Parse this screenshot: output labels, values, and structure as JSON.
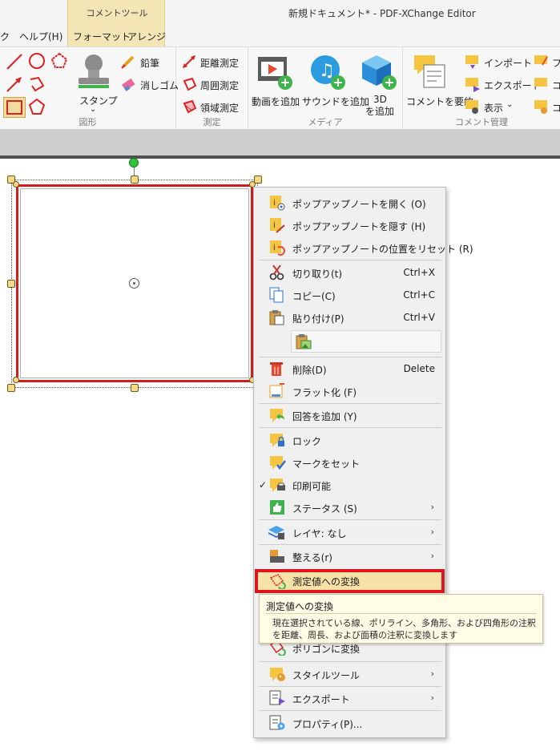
{
  "window": {
    "title": "新規ドキュメント* - PDF-XChange Editor",
    "context_tab_group": "コメントツール"
  },
  "menubar": {
    "items": [
      {
        "label": "ク"
      },
      {
        "label": "ヘルプ(H)"
      },
      {
        "label": "フォーマット"
      },
      {
        "label": "アレンジ"
      }
    ]
  },
  "ribbon": {
    "groups": {
      "shapes": {
        "label": "図形"
      },
      "measure": {
        "label": "測定"
      },
      "media": {
        "label": "メディア"
      },
      "comments": {
        "label": "コメント管理"
      }
    },
    "stamp": "スタンプ",
    "pencil": "鉛筆",
    "eraser": "消しゴム",
    "distance": "距離測定",
    "perimeter": "周囲測定",
    "area": "領域測定",
    "add_video": "動画を追加",
    "add_sound": "サウンドを追加",
    "add_3d_line1": "3D",
    "add_3d_line2": "を追加",
    "summarize": "コメントを要約",
    "import": "インポート",
    "export": "エクスポート",
    "view": "表示",
    "clip1": "フ",
    "clip2": "コ",
    "clip3": "コ"
  },
  "context_menu": {
    "items": [
      {
        "label": "ポップアップノートを開く (O)"
      },
      {
        "label": "ポップアップノートを隠す (H)"
      },
      {
        "label": "ポップアップノートの位置をリセット (R)"
      },
      {
        "label": "切り取り(t)",
        "shortcut": "Ctrl+X"
      },
      {
        "label": "コピー(C)",
        "shortcut": "Ctrl+C"
      },
      {
        "label": "貼り付け(P)",
        "shortcut": "Ctrl+V"
      },
      {
        "label": "削除(D)",
        "shortcut": "Delete"
      },
      {
        "label": "フラット化 (F)"
      },
      {
        "label": "回答を追加 (Y)"
      },
      {
        "label": "ロック"
      },
      {
        "label": "マークをセット"
      },
      {
        "label": "印刷可能",
        "checked": "✓"
      },
      {
        "label": "ステータス (S)",
        "arrow": "›"
      },
      {
        "label": "レイヤ: なし",
        "arrow": "›"
      },
      {
        "label": "整える(r)",
        "arrow": "›"
      },
      {
        "label": "測定値への変換"
      },
      {
        "label": "ポリゴンに変換"
      },
      {
        "label": "スタイルツール",
        "arrow": "›"
      },
      {
        "label": "エクスポート",
        "arrow": "›"
      },
      {
        "label": "プロパティ(P)..."
      }
    ]
  },
  "tooltip": {
    "title": "測定値への変換",
    "description": "現在選択されている線、ポリライン、多角形、および四角形の注釈を距離、周長、および面積の注釈に変換します"
  },
  "colors": {
    "highlight_border": "#e0141e",
    "highlight_fill": "#f6e2a6",
    "shape_border": "#d31c1c",
    "context_tab": "#f3e6b4"
  }
}
